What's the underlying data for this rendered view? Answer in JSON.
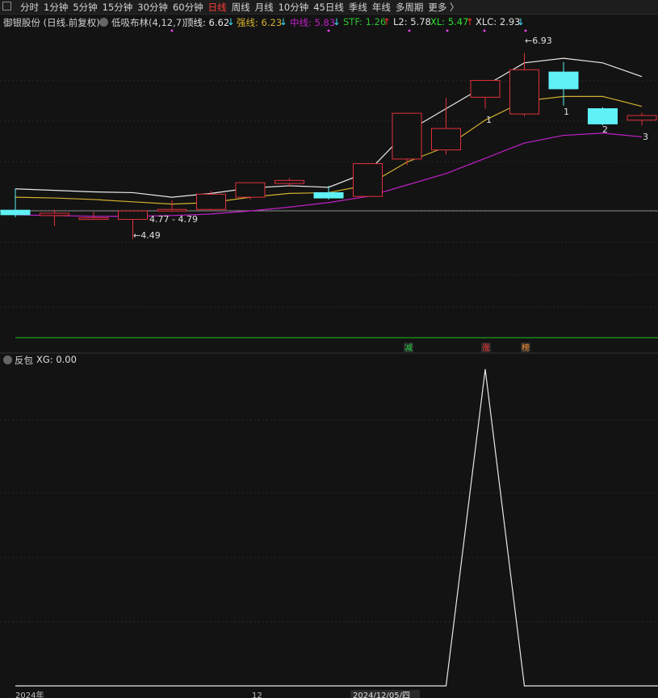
{
  "toolbar": {
    "items": [
      "分时",
      "1分钟",
      "5分钟",
      "15分钟",
      "30分钟",
      "60分钟",
      "日线",
      "周线",
      "月线",
      "10分钟",
      "45日线",
      "季线",
      "年线",
      "多周期",
      "更多 〉"
    ],
    "active_index": 6
  },
  "header": {
    "stock_name": "御银股份 (日线.前复权)",
    "indicator": "低吸布林(4,12,7)",
    "top_label": "顶线: 6.62",
    "strong_label": "强线: 6.23",
    "mid_label": "中线: 5.83",
    "stf_label": "STF: 1.26",
    "l2_label": "L2: 5.78",
    "xl_label": "XL: 5.47",
    "xlc_label": "XLC: 2.93",
    "arrow_up": "↑",
    "arrow_down": "↓"
  },
  "sub": {
    "title": "反包",
    "xg_label": "XG: 0.00"
  },
  "axis": {
    "label_left": "2024年",
    "label_mid": "12",
    "label_date": "2024/12/05/四"
  },
  "colors": {
    "up": "#e0303c",
    "down": "#5ef2f6",
    "top_line": "#e8e8e8",
    "strong_line": "#d4b030",
    "mid_line": "#c020c8",
    "green_line": "#20c020",
    "background": "#131313",
    "grid": "#2a2a2a"
  },
  "chart_data": {
    "type": "candlestick",
    "candles": [
      {
        "o": 4.87,
        "c": 4.81,
        "h": 5.15,
        "l": 4.78
      },
      {
        "o": 4.8,
        "c": 4.83,
        "h": 4.88,
        "l": 4.66
      },
      {
        "o": 4.77,
        "c": 4.77,
        "h": 4.85,
        "l": 4.77
      },
      {
        "o": 4.75,
        "c": 4.86,
        "h": 4.85,
        "l": 4.49
      },
      {
        "o": 4.88,
        "c": 4.88,
        "h": 5.0,
        "l": 4.85
      },
      {
        "o": 4.88,
        "c": 5.08,
        "h": 5.12,
        "l": 4.86
      },
      {
        "o": 5.04,
        "c": 5.23,
        "h": 5.23,
        "l": 5.01
      },
      {
        "o": 5.22,
        "c": 5.26,
        "h": 5.29,
        "l": 5.18
      },
      {
        "o": 5.1,
        "c": 5.03,
        "h": 5.19,
        "l": 5.01
      },
      {
        "o": 5.05,
        "c": 5.48,
        "h": 5.48,
        "l": 5.05
      },
      {
        "o": 5.54,
        "c": 6.14,
        "h": 6.14,
        "l": 5.46
      },
      {
        "o": 5.66,
        "c": 5.94,
        "h": 6.34,
        "l": 5.6
      },
      {
        "o": 6.35,
        "c": 6.57,
        "h": 6.57,
        "l": 6.2
      },
      {
        "o": 6.13,
        "c": 6.71,
        "h": 6.93,
        "l": 6.1
      },
      {
        "o": 6.68,
        "c": 6.46,
        "h": 6.81,
        "l": 6.24
      },
      {
        "o": 6.2,
        "c": 6.0,
        "h": 6.22,
        "l": 5.98
      },
      {
        "o": 6.05,
        "c": 6.11,
        "h": 6.15,
        "l": 5.98
      }
    ],
    "top_line": [
      5.15,
      5.13,
      5.11,
      5.1,
      5.04,
      5.09,
      5.16,
      5.19,
      5.17,
      5.37,
      5.9,
      6.2,
      6.5,
      6.8,
      6.86,
      6.8,
      6.62
    ],
    "strong_line": [
      5.04,
      5.03,
      5.01,
      4.98,
      4.95,
      4.97,
      5.04,
      5.09,
      5.1,
      5.2,
      5.5,
      5.7,
      6.05,
      6.3,
      6.36,
      6.36,
      6.23
    ],
    "mid_line": [
      4.81,
      4.8,
      4.79,
      4.79,
      4.8,
      4.82,
      4.86,
      4.91,
      4.97,
      5.05,
      5.2,
      5.35,
      5.55,
      5.75,
      5.85,
      5.88,
      5.83
    ],
    "annotations": [
      {
        "index": 3,
        "text": "4.77 - 4.79"
      },
      {
        "index": 3,
        "text": "←4.49"
      },
      {
        "index": 13,
        "text": "←6.93"
      },
      {
        "index": 14,
        "text": "1"
      },
      {
        "index": 12,
        "text": "1"
      },
      {
        "index": 15,
        "text": "2"
      },
      {
        "index": 16,
        "text": "3"
      }
    ],
    "markers": [
      {
        "index": 10,
        "text": "减",
        "color": "#20d040"
      },
      {
        "index": 12,
        "text": "涨",
        "color": "#ff3030"
      },
      {
        "index": 13,
        "text": "榜",
        "color": "#ff9030"
      }
    ],
    "ylim": [
      3.2,
      7.2
    ],
    "sub": {
      "type": "line",
      "name": "XG",
      "values": [
        0,
        0,
        0,
        0,
        0,
        0,
        0,
        0,
        0,
        0,
        0,
        0,
        1,
        0,
        0,
        0,
        0
      ],
      "ylim": [
        0,
        1
      ]
    }
  }
}
